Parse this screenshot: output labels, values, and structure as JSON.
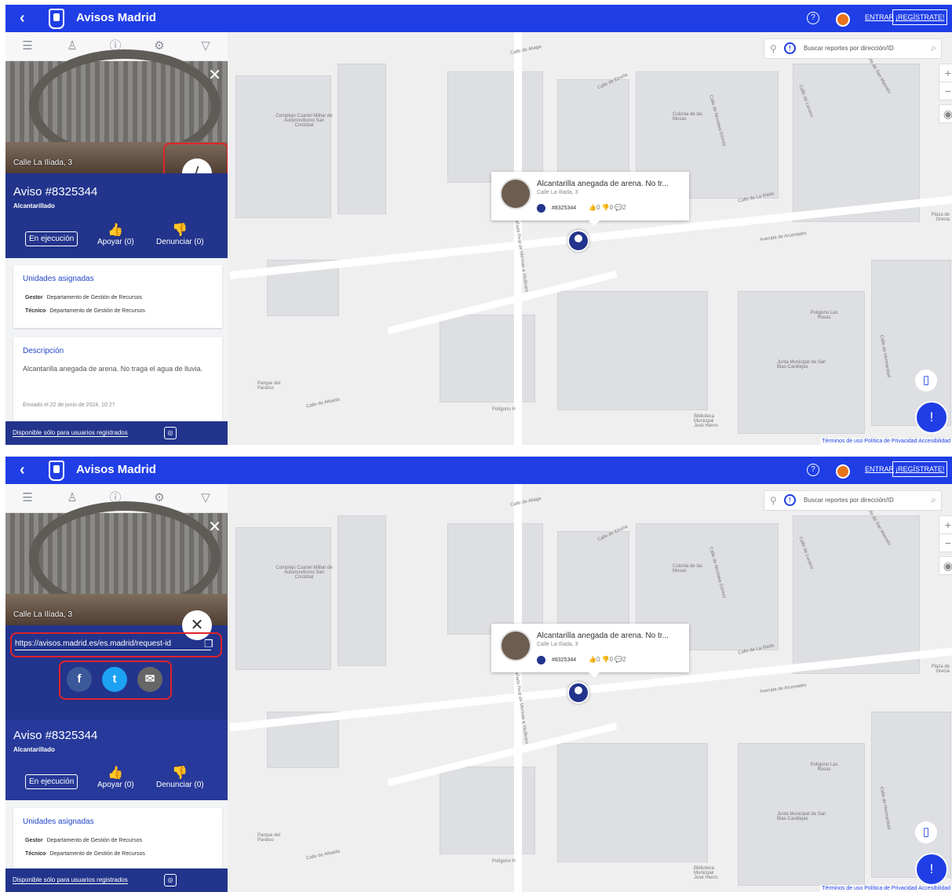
{
  "app": {
    "title": "Avisos Madrid",
    "help": "?",
    "login": "ENTRAR",
    "register": "¡REGÍSTRATE!"
  },
  "report": {
    "street": "Calle La Ilíada, 3",
    "title": "Aviso #8325344",
    "category": "Alcantarillado",
    "status": "En ejecución",
    "support": "Apoyar (0)",
    "report_abuse": "Denunciar (0)",
    "units_title": "Unidades asignadas",
    "gestor_label": "Gestor",
    "gestor_value": "Departamento de Gestión de Recursos",
    "tecnico_label": "Técnico",
    "tecnico_value": "Departamento de Gestión de Recursos",
    "desc_title": "Descripción",
    "description": "Alcantarilla anegada de arena. No traga el agua de lluvia.",
    "sent": "Enviado el 22 de junio de 2024, 10:27",
    "bottom_note": "Disponible sólo para usuarios registrados"
  },
  "share": {
    "url": "https://avisos.madrid.es/es.madrid/request-id",
    "facebook": "f",
    "twitter": "t",
    "email": "✉"
  },
  "map": {
    "search_placeholder": "Buscar reportes por dirección/ID",
    "popup_title": "Alcantarilla anegada de arena. No tr...",
    "popup_address": "Calle La Ilíada, 3",
    "popup_id": "#8325344",
    "popup_stats": "👍0  👎0  💬2",
    "labels": [
      "Calle de Aliaga",
      "Calle de Etruria",
      "Complejo Cuartel Militar de Automovilismo San Cristóbal",
      "Colonia de las Musas",
      "Calle de Nicolasa Gómez",
      "Calle de Lucano",
      "Calle de San Marcelo",
      "Calle de La Ilíada",
      "Avenida de Arcentales",
      "Cañada Real de Merinas a Vicálvaro",
      "Polígono Las Rosas",
      "Parque del Paraíso",
      "Calle de Albaida",
      "Polígono H",
      "Junta Municipal de San Blas-Canillejas",
      "Biblioteca Municipal José Hierro",
      "Calle de Hermandad",
      "Plaza de Grecia"
    ],
    "terms": "Términos de uso  Política de Privacidad  Accesibilidad"
  },
  "colors": {
    "brand": "#1f3ee6",
    "panel": "#22348c",
    "highlight": "#e0232a"
  }
}
